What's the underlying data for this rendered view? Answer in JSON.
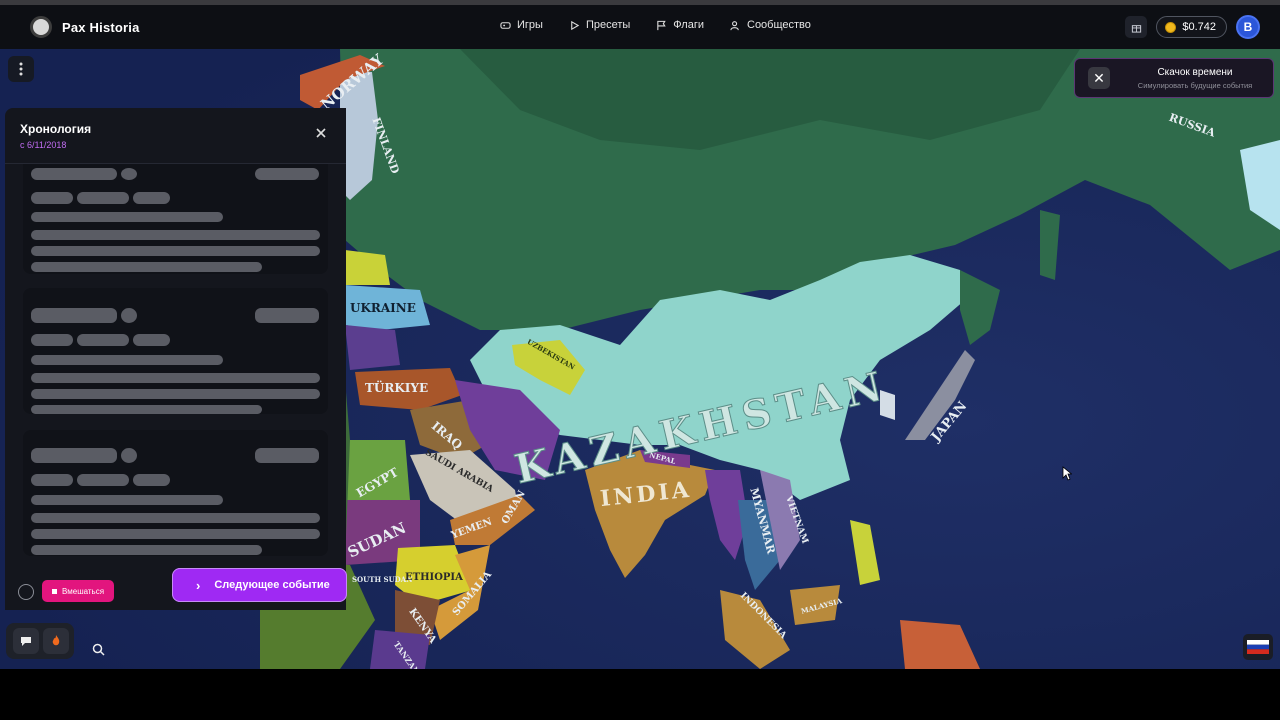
{
  "brand": {
    "name": "Pax Historia"
  },
  "nav": {
    "items": [
      {
        "label": "Игры",
        "icon": "gamepad-icon"
      },
      {
        "label": "Пресеты",
        "icon": "play-icon"
      },
      {
        "label": "Флаги",
        "icon": "flag-icon"
      },
      {
        "label": "Сообщество",
        "icon": "users-icon"
      }
    ]
  },
  "account": {
    "balance": "$0.742",
    "avatar_initial": "B"
  },
  "timeline": {
    "title": "Хронология",
    "subtitle": "с 6/11/2018",
    "intervene_label": "Вмешаться",
    "next_event_label": "Следующее событие"
  },
  "toast": {
    "title": "Скачок времени",
    "subtitle": "Симулировать будущие события"
  },
  "map": {
    "labels": [
      "KAZAKHSTAN",
      "INDIA",
      "JAPAN",
      "RUSSIA",
      "FINLAND",
      "UKRAINE",
      "TÜRKIYE",
      "IRAQ",
      "EGYPT",
      "SAUDI ARABIA",
      "YEMEN",
      "OMAN",
      "SUDAN",
      "SOUTH SUDAN",
      "ETHIOPIA",
      "SOMALIA",
      "KENYA",
      "TANZANIA",
      "UZBEKISTAN",
      "NEPAL",
      "MYANMAR",
      "VIETNAM",
      "INDONESIA",
      "MALAYSIA",
      "NORWAY"
    ],
    "colors": {
      "ocean": "#1b2a5e",
      "russia": "#2e6a4a",
      "kazakhstan": "#8fd6cc",
      "india": "#b88a3c"
    }
  }
}
